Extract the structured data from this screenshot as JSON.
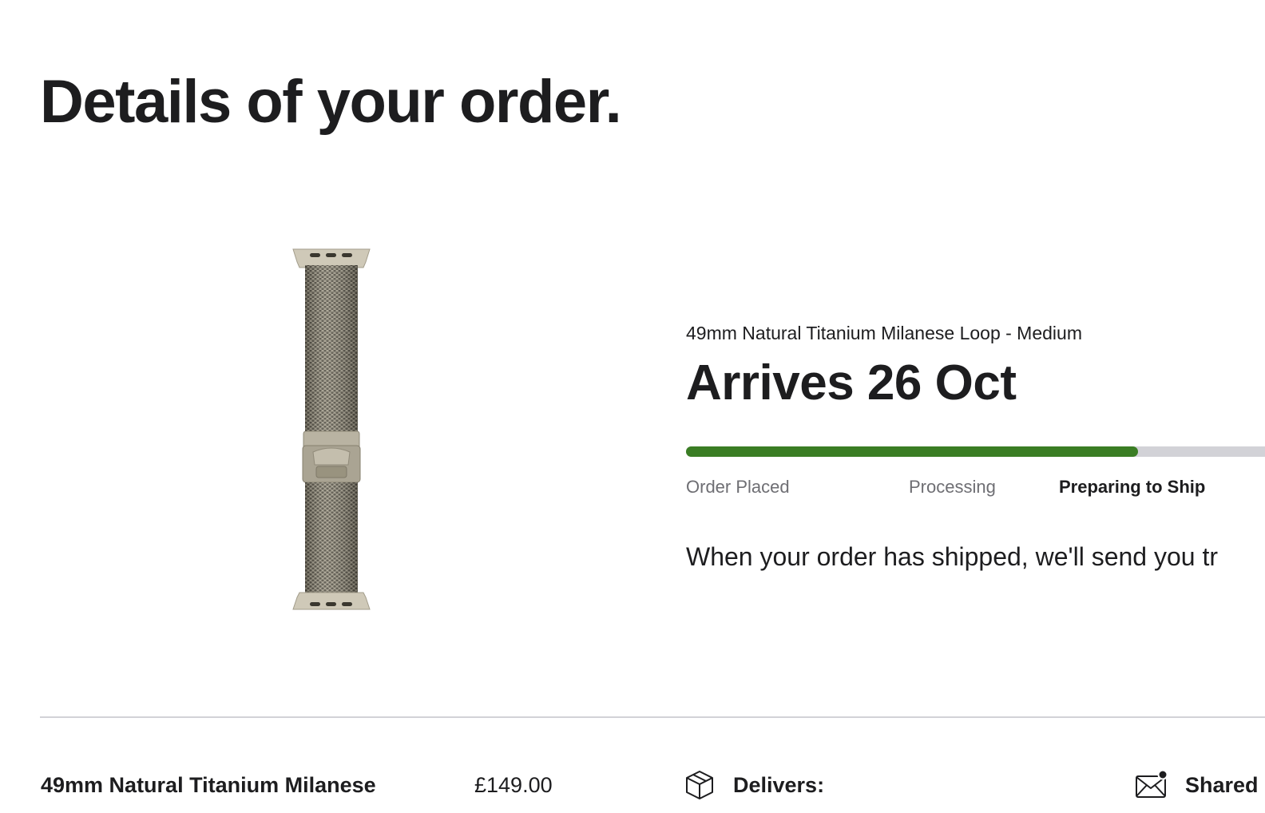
{
  "page": {
    "title": "Details of your order."
  },
  "product": {
    "image_icon": "milanese-loop-band-image",
    "name": "49mm Natural Titanium Milanese Loop - Medium"
  },
  "status": {
    "arrival": "Arrives 26 Oct",
    "progress_fraction": 0.745,
    "colors": {
      "progress_fill": "#3a7d24",
      "progress_track": "#d2d2d7"
    },
    "steps": [
      {
        "label": "Order Placed",
        "active": false
      },
      {
        "label": "Processing",
        "active": false
      },
      {
        "label": "Preparing to Ship",
        "active": true
      }
    ],
    "message": "When your order has shipped, we'll send you tr"
  },
  "summary": {
    "item_name": "49mm Natural Titanium Milanese",
    "price": "£149.00",
    "delivers_icon": "box-icon",
    "delivers_label": "Delivers:",
    "shared_icon": "envelope-icon",
    "shared_label": "Shared"
  }
}
